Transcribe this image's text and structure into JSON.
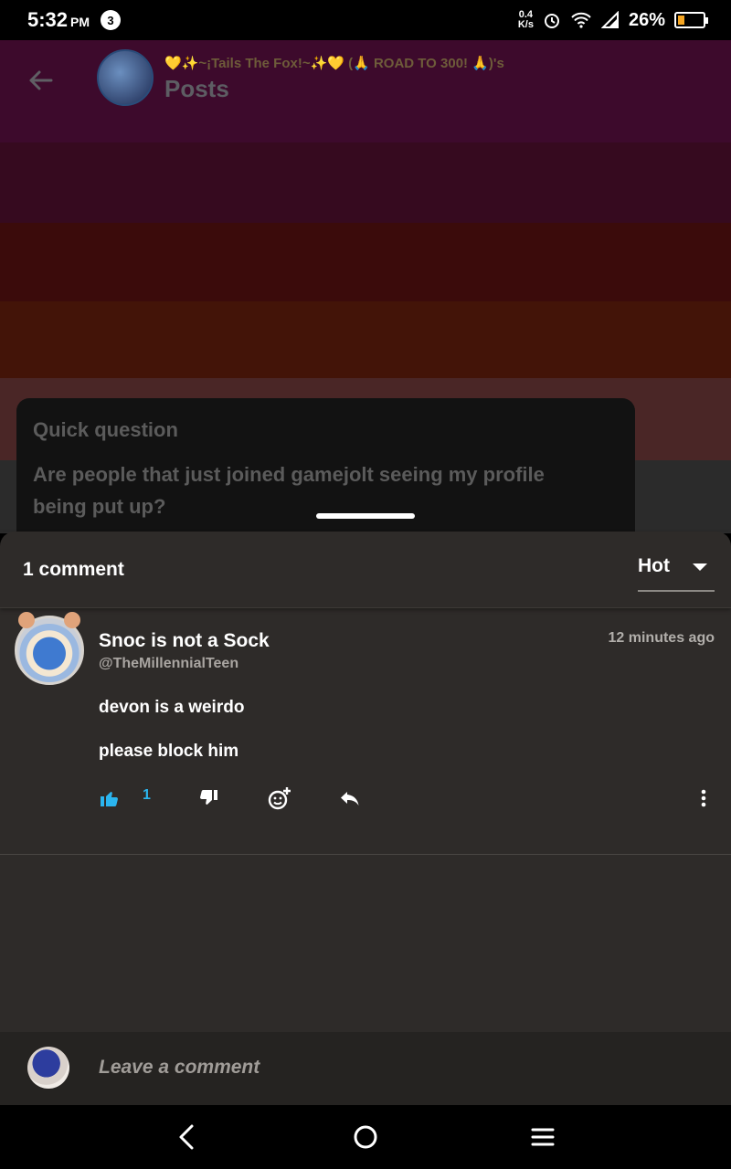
{
  "status_bar": {
    "time": "5:32",
    "ampm": "PM",
    "notification_count": "3",
    "net_speed_value": "0.4",
    "net_speed_unit": "K/s",
    "battery_percent": "26%",
    "battery_level": 0.26,
    "battery_color": "#f5a623"
  },
  "header": {
    "subtitle": "💛✨~¡Tails The Fox!~✨💛 (🙏 ROAD TO 300! 🙏)'s",
    "title": "Posts",
    "back_icon": "arrow-left-icon"
  },
  "post": {
    "title": "Quick question",
    "body": "Are people that just joined gamejolt seeing my profile being put up?"
  },
  "comments_sheet": {
    "count_label": "1 comment",
    "sort_selected": "Hot"
  },
  "comments": [
    {
      "display_name": "Snoc is not a Sock",
      "username": "@TheMillennialTeen",
      "time": "12 minutes ago",
      "lines": [
        "devon is a weirdo",
        "please block him"
      ],
      "likes": "1"
    }
  ],
  "composer": {
    "placeholder": "Leave a comment"
  },
  "colors": {
    "accent": "#2bb5ef",
    "sheet_bg": "#2e2b29"
  }
}
